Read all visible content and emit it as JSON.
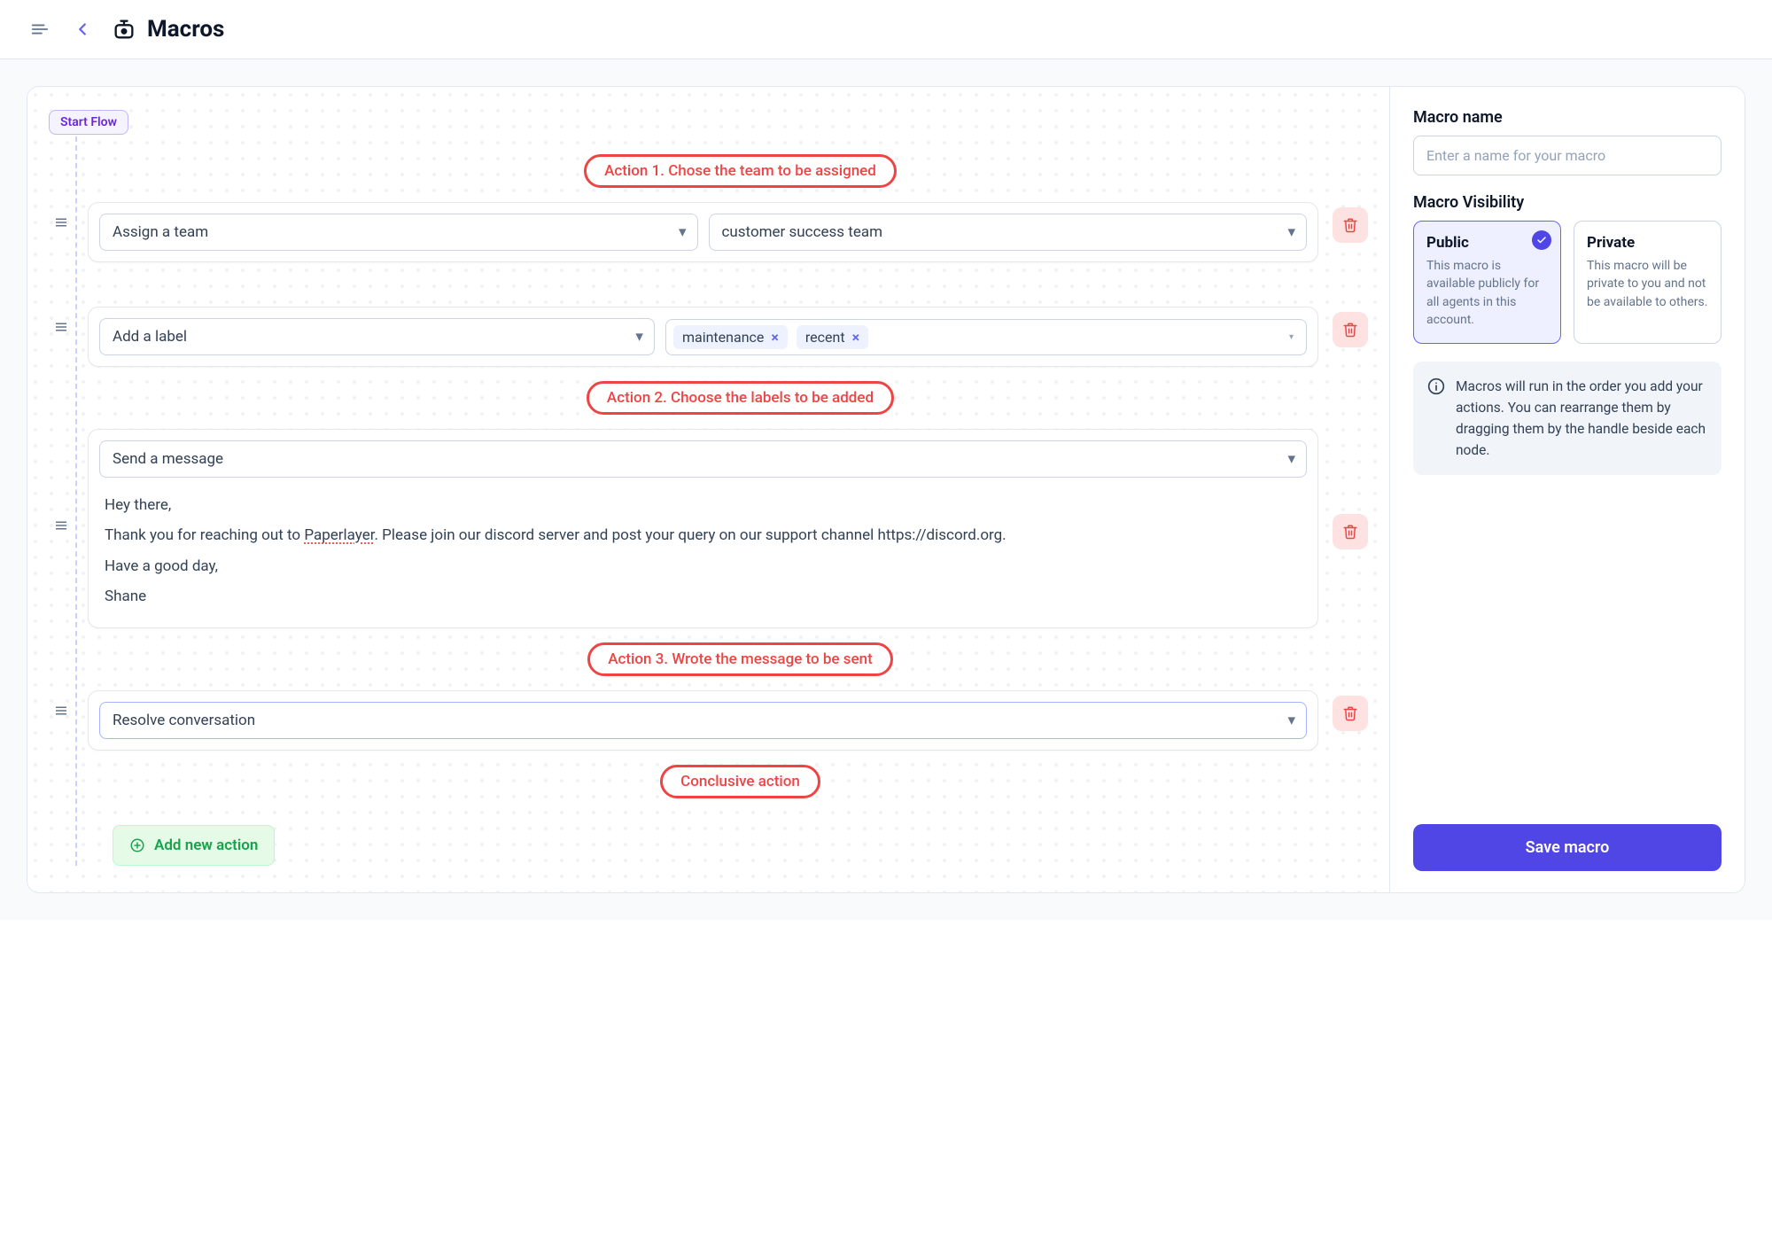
{
  "header": {
    "title": "Macros"
  },
  "flow": {
    "start_label": "Start Flow",
    "annotations": {
      "a1": "Action 1. Chose the team to be assigned",
      "a2": "Action 2. Choose the labels to be added",
      "a3": "Action 3. Wrote the message  to be sent",
      "a4": "Conclusive action"
    },
    "actions": [
      {
        "type_label": "Assign a team",
        "value_label": "customer success team"
      },
      {
        "type_label": "Add a label",
        "tags": [
          "maintenance",
          "recent"
        ]
      },
      {
        "type_label": "Send a message",
        "message_greeting": "Hey there,",
        "message_body": "Thank you for reaching out to Paperlayer. Please join our discord server and post your query on our support channel https://discord.org.",
        "message_closing": "Have  a  good day,",
        "message_sign": "Shane",
        "underline_word": "Paperlayer"
      },
      {
        "type_label": "Resolve conversation"
      }
    ],
    "add_button_label": "Add new action"
  },
  "side": {
    "name_label": "Macro name",
    "name_placeholder": "Enter a name for your macro",
    "visibility_label": "Macro Visibility",
    "visibility": [
      {
        "title": "Public",
        "desc": "This macro is available publicly for all agents in this account.",
        "selected": true
      },
      {
        "title": "Private",
        "desc": "This macro will be private to you and not be available to others.",
        "selected": false
      }
    ],
    "info": "Macros will run in the order you add your actions. You can rearrange them by dragging them by the handle beside each node.",
    "save_label": "Save macro"
  }
}
